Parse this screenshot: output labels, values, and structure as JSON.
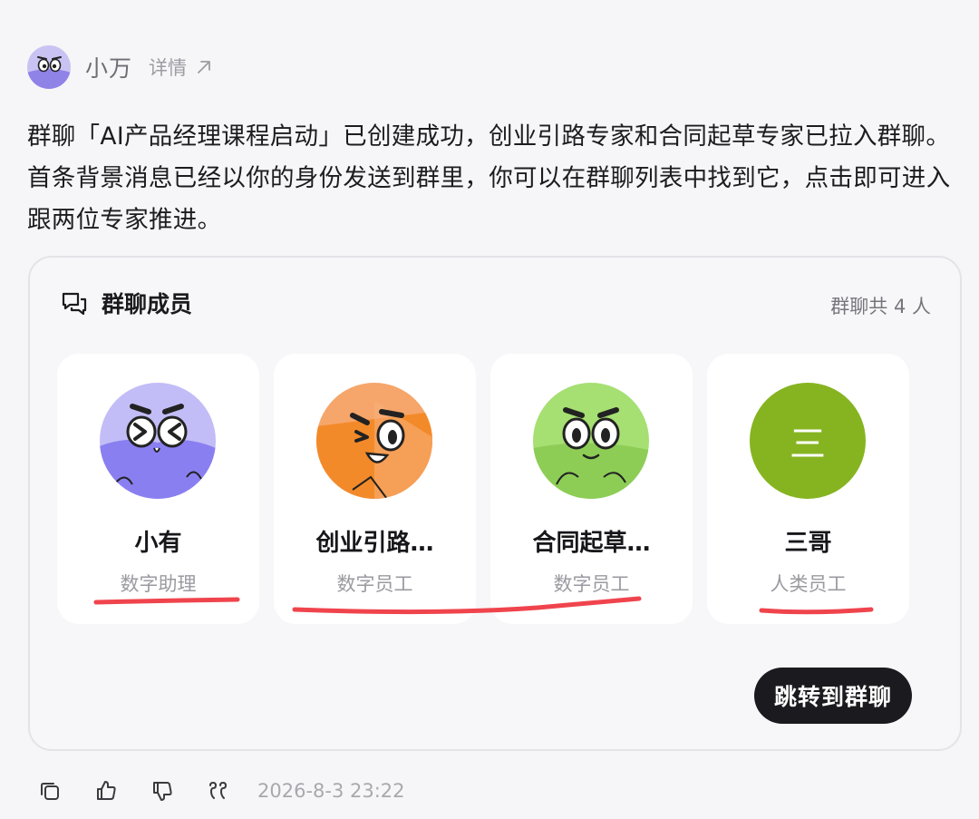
{
  "header": {
    "bot_name": "小万",
    "detail_label": "详情",
    "avatar_icon": "cartoon-face-avatar",
    "detail_icon": "arrow-up-right-icon"
  },
  "message": {
    "text": "群聊「AI产品经理课程启动」已创建成功，创业引路专家和合同起草专家已拉入群聊。首条背景消息已经以你的身份发送到群里，你可以在群聊列表中找到它，点击即可进入跟两位专家推进。"
  },
  "card": {
    "title": "群聊成员",
    "title_icon": "chat-bubbles-icon",
    "member_count": "群聊共 4 人",
    "members": [
      {
        "name": "小有",
        "role": "数字助理",
        "avatar": "purple-cartoon-avatar"
      },
      {
        "name": "创业引路…",
        "role": "数字员工",
        "avatar": "orange-cartoon-avatar"
      },
      {
        "name": "合同起草…",
        "role": "数字员工",
        "avatar": "green-cartoon-avatar"
      },
      {
        "name": "三哥",
        "role": "人类员工",
        "avatar_letter": "三",
        "avatar": "letter-avatar"
      }
    ],
    "jump_label": "跳转到群聊"
  },
  "colors": {
    "highlight": "#f0444d",
    "button_bg": "#1b1b1f",
    "letter_avatar_bg": "#86b420"
  },
  "footer": {
    "actions": [
      "copy-icon",
      "thumbs-up-icon",
      "thumbs-down-icon",
      "quote-icon"
    ],
    "timestamp": "2026-8-3 23:22"
  }
}
